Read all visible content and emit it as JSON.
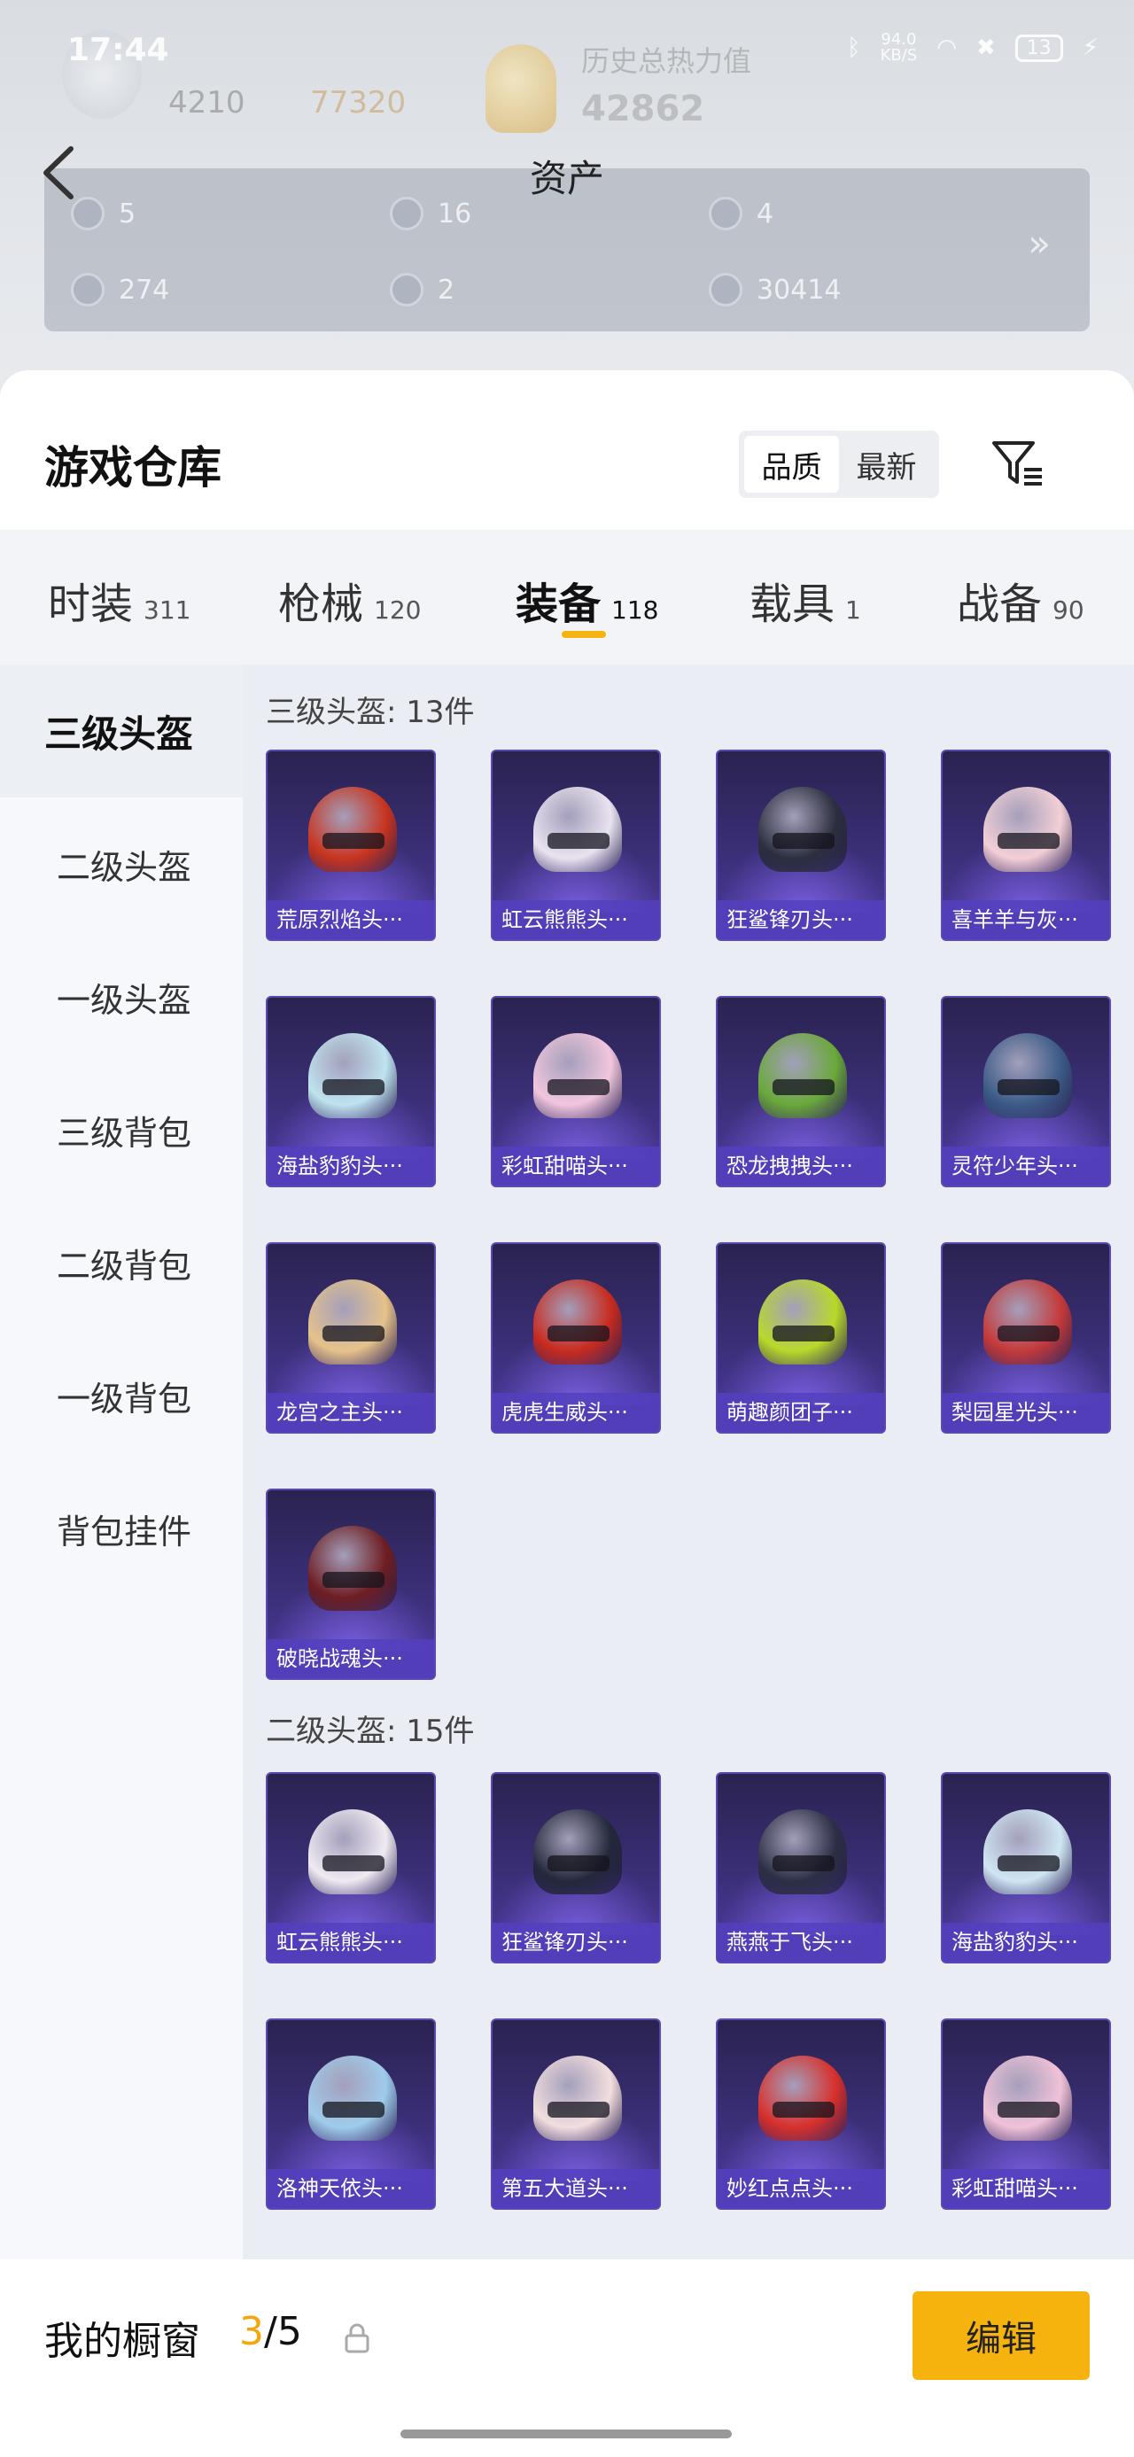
{
  "status_bar": {
    "time": "17:44",
    "net_speed": "94.0",
    "net_unit": "KB/S",
    "battery": "13"
  },
  "profile": {
    "history_label": "历史总热力值",
    "history_value": "42862",
    "stat1": "4210",
    "stat2": "77320"
  },
  "nav": {
    "title": "资产"
  },
  "assets": [
    {
      "value": "5"
    },
    {
      "value": "16"
    },
    {
      "value": "4"
    },
    {
      "value": "274"
    },
    {
      "value": "2"
    },
    {
      "value": "30414"
    }
  ],
  "sheet": {
    "title": "游戏仓库",
    "sort_quality": "品质",
    "sort_latest": "最新"
  },
  "tabs": [
    {
      "label": "时装",
      "count": "311"
    },
    {
      "label": "枪械",
      "count": "120"
    },
    {
      "label": "装备",
      "count": "118"
    },
    {
      "label": "载具",
      "count": "1"
    },
    {
      "label": "战备",
      "count": "90"
    }
  ],
  "sidebar": [
    {
      "label": "三级头盔"
    },
    {
      "label": "二级头盔"
    },
    {
      "label": "一级头盔"
    },
    {
      "label": "三级背包"
    },
    {
      "label": "二级背包"
    },
    {
      "label": "一级背包"
    },
    {
      "label": "背包挂件"
    }
  ],
  "sections": [
    {
      "title": "三级头盔: 13件",
      "items": [
        {
          "name": "荒原烈焰头···",
          "color": "#c8341f"
        },
        {
          "name": "虹云熊熊头···",
          "color": "#e9e2ef"
        },
        {
          "name": "狂鲨锋刃头···",
          "color": "#2b2f3e"
        },
        {
          "name": "喜羊羊与灰···",
          "color": "#f3cfd6"
        },
        {
          "name": "海盐豹豹头···",
          "color": "#bfe3ef"
        },
        {
          "name": "彩虹甜喵头···",
          "color": "#f1c6dc"
        },
        {
          "name": "恐龙拽拽头···",
          "color": "#6aa83a"
        },
        {
          "name": "灵符少年头···",
          "color": "#3b5b86"
        },
        {
          "name": "龙宫之主头···",
          "color": "#e6c28a"
        },
        {
          "name": "虎虎生威头···",
          "color": "#c82b1f"
        },
        {
          "name": "萌趣颜团子···",
          "color": "#b8d92a"
        },
        {
          "name": "梨园星光头···",
          "color": "#c43a3a"
        },
        {
          "name": "破晓战魂头···",
          "color": "#6e1e22"
        }
      ]
    },
    {
      "title": "二级头盔: 15件",
      "items": [
        {
          "name": "虹云熊熊头···",
          "color": "#f0eaf2"
        },
        {
          "name": "狂鲨锋刃头···",
          "color": "#23283a"
        },
        {
          "name": "燕燕于飞头···",
          "color": "#2c2f45"
        },
        {
          "name": "海盐豹豹头···",
          "color": "#cfe6f3"
        },
        {
          "name": "洛神天依头···",
          "color": "#9fcbea"
        },
        {
          "name": "第五大道头···",
          "color": "#f2dede"
        },
        {
          "name": "妙红点点头···",
          "color": "#d8302c"
        },
        {
          "name": "彩虹甜喵头···",
          "color": "#f0c2d8"
        }
      ]
    }
  ],
  "bottom_bar": {
    "title": "我的橱窗",
    "current": "3",
    "total": "/5",
    "edit_label": "编辑"
  }
}
